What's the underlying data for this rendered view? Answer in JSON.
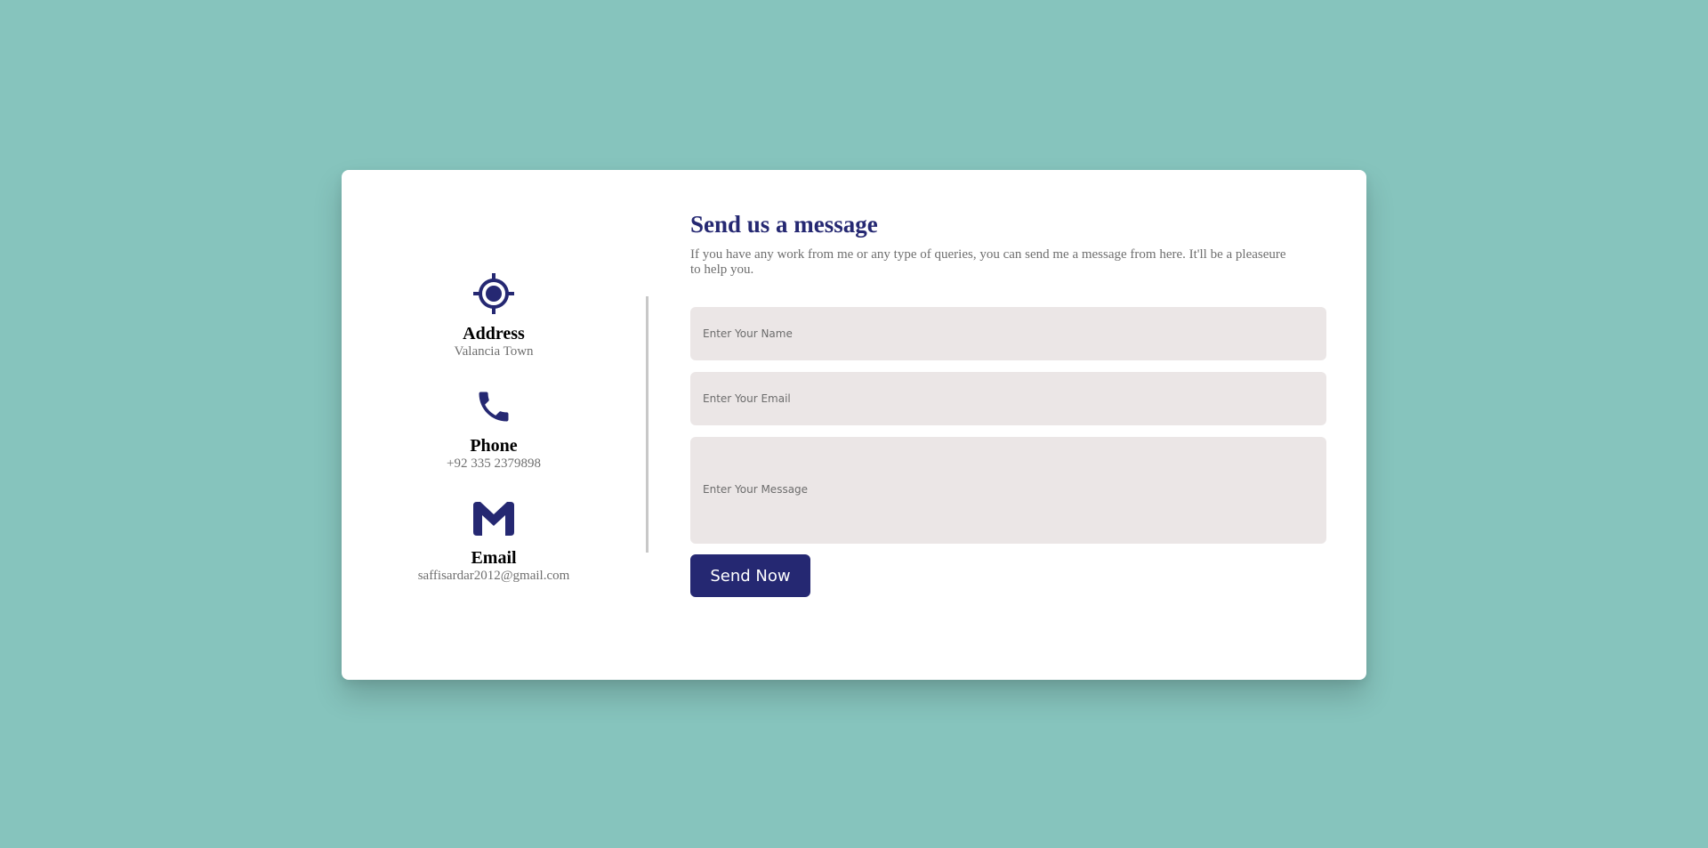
{
  "page": {
    "background_color": "#86c4bd",
    "card_color": "#ffffff",
    "accent_color": "#252872"
  },
  "contact": {
    "address": {
      "icon": "location-target-icon",
      "title": "Address",
      "text": "Valancia Town"
    },
    "phone": {
      "icon": "phone-icon",
      "title": "Phone",
      "text": "+92 335 2379898"
    },
    "email": {
      "icon": "gmail-m-icon",
      "title": "Email",
      "text": "saffisardar2012@gmail.com"
    }
  },
  "form": {
    "title": "Send us a message",
    "subtitle": "If you have any work from me or any type of queries, you can send me a message from here. It'll be a pleaseure to help you.",
    "name_placeholder": "Enter Your Name",
    "name_value": "",
    "email_placeholder": "Enter Your Email",
    "email_value": "",
    "message_placeholder": "Enter Your Message",
    "message_value": "",
    "submit_label": "Send Now"
  }
}
